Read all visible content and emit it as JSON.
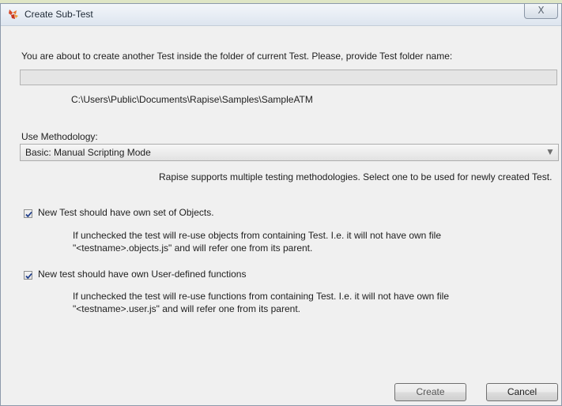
{
  "window": {
    "title": "Create Sub-Test",
    "close_glyph": "X",
    "icon": "rapise-app-icon"
  },
  "dialog": {
    "prompt": "You are about to create another Test inside the folder of current Test. Please, provide Test folder name:",
    "test_folder_name": {
      "value": "",
      "placeholder": ""
    },
    "path": "C:\\Users\\Public\\Documents\\Rapise\\Samples\\SampleATM",
    "methodology": {
      "label": "Use Methodology:",
      "selected": "Basic: Manual Scripting Mode",
      "arrow_glyph": "▼",
      "hint": "Rapise supports multiple testing methodologies. Select one to be used for newly created Test."
    },
    "own_objects": {
      "checked": true,
      "label": "New Test should have own set of Objects.",
      "desc_line1": "If unchecked the test will re-use objects from containing Test. I.e. it will not have own file",
      "desc_line2": "\"<testname>.objects.js\" and will refer one from its parent."
    },
    "own_functions": {
      "checked": true,
      "label": "New test should have own User-defined functions",
      "desc_line1": "If unchecked the test will re-use functions from containing Test. I.e. it will not have own file",
      "desc_line2": "\"<testname>.user.js\" and will refer one from its parent."
    }
  },
  "buttons": {
    "create": "Create",
    "cancel": "Cancel"
  },
  "colors": {
    "window_background": "#f0f0f0",
    "titlebar": "#dde5ef",
    "input_background": "#e5e5e5",
    "checkmark": "#1a3a8a"
  }
}
